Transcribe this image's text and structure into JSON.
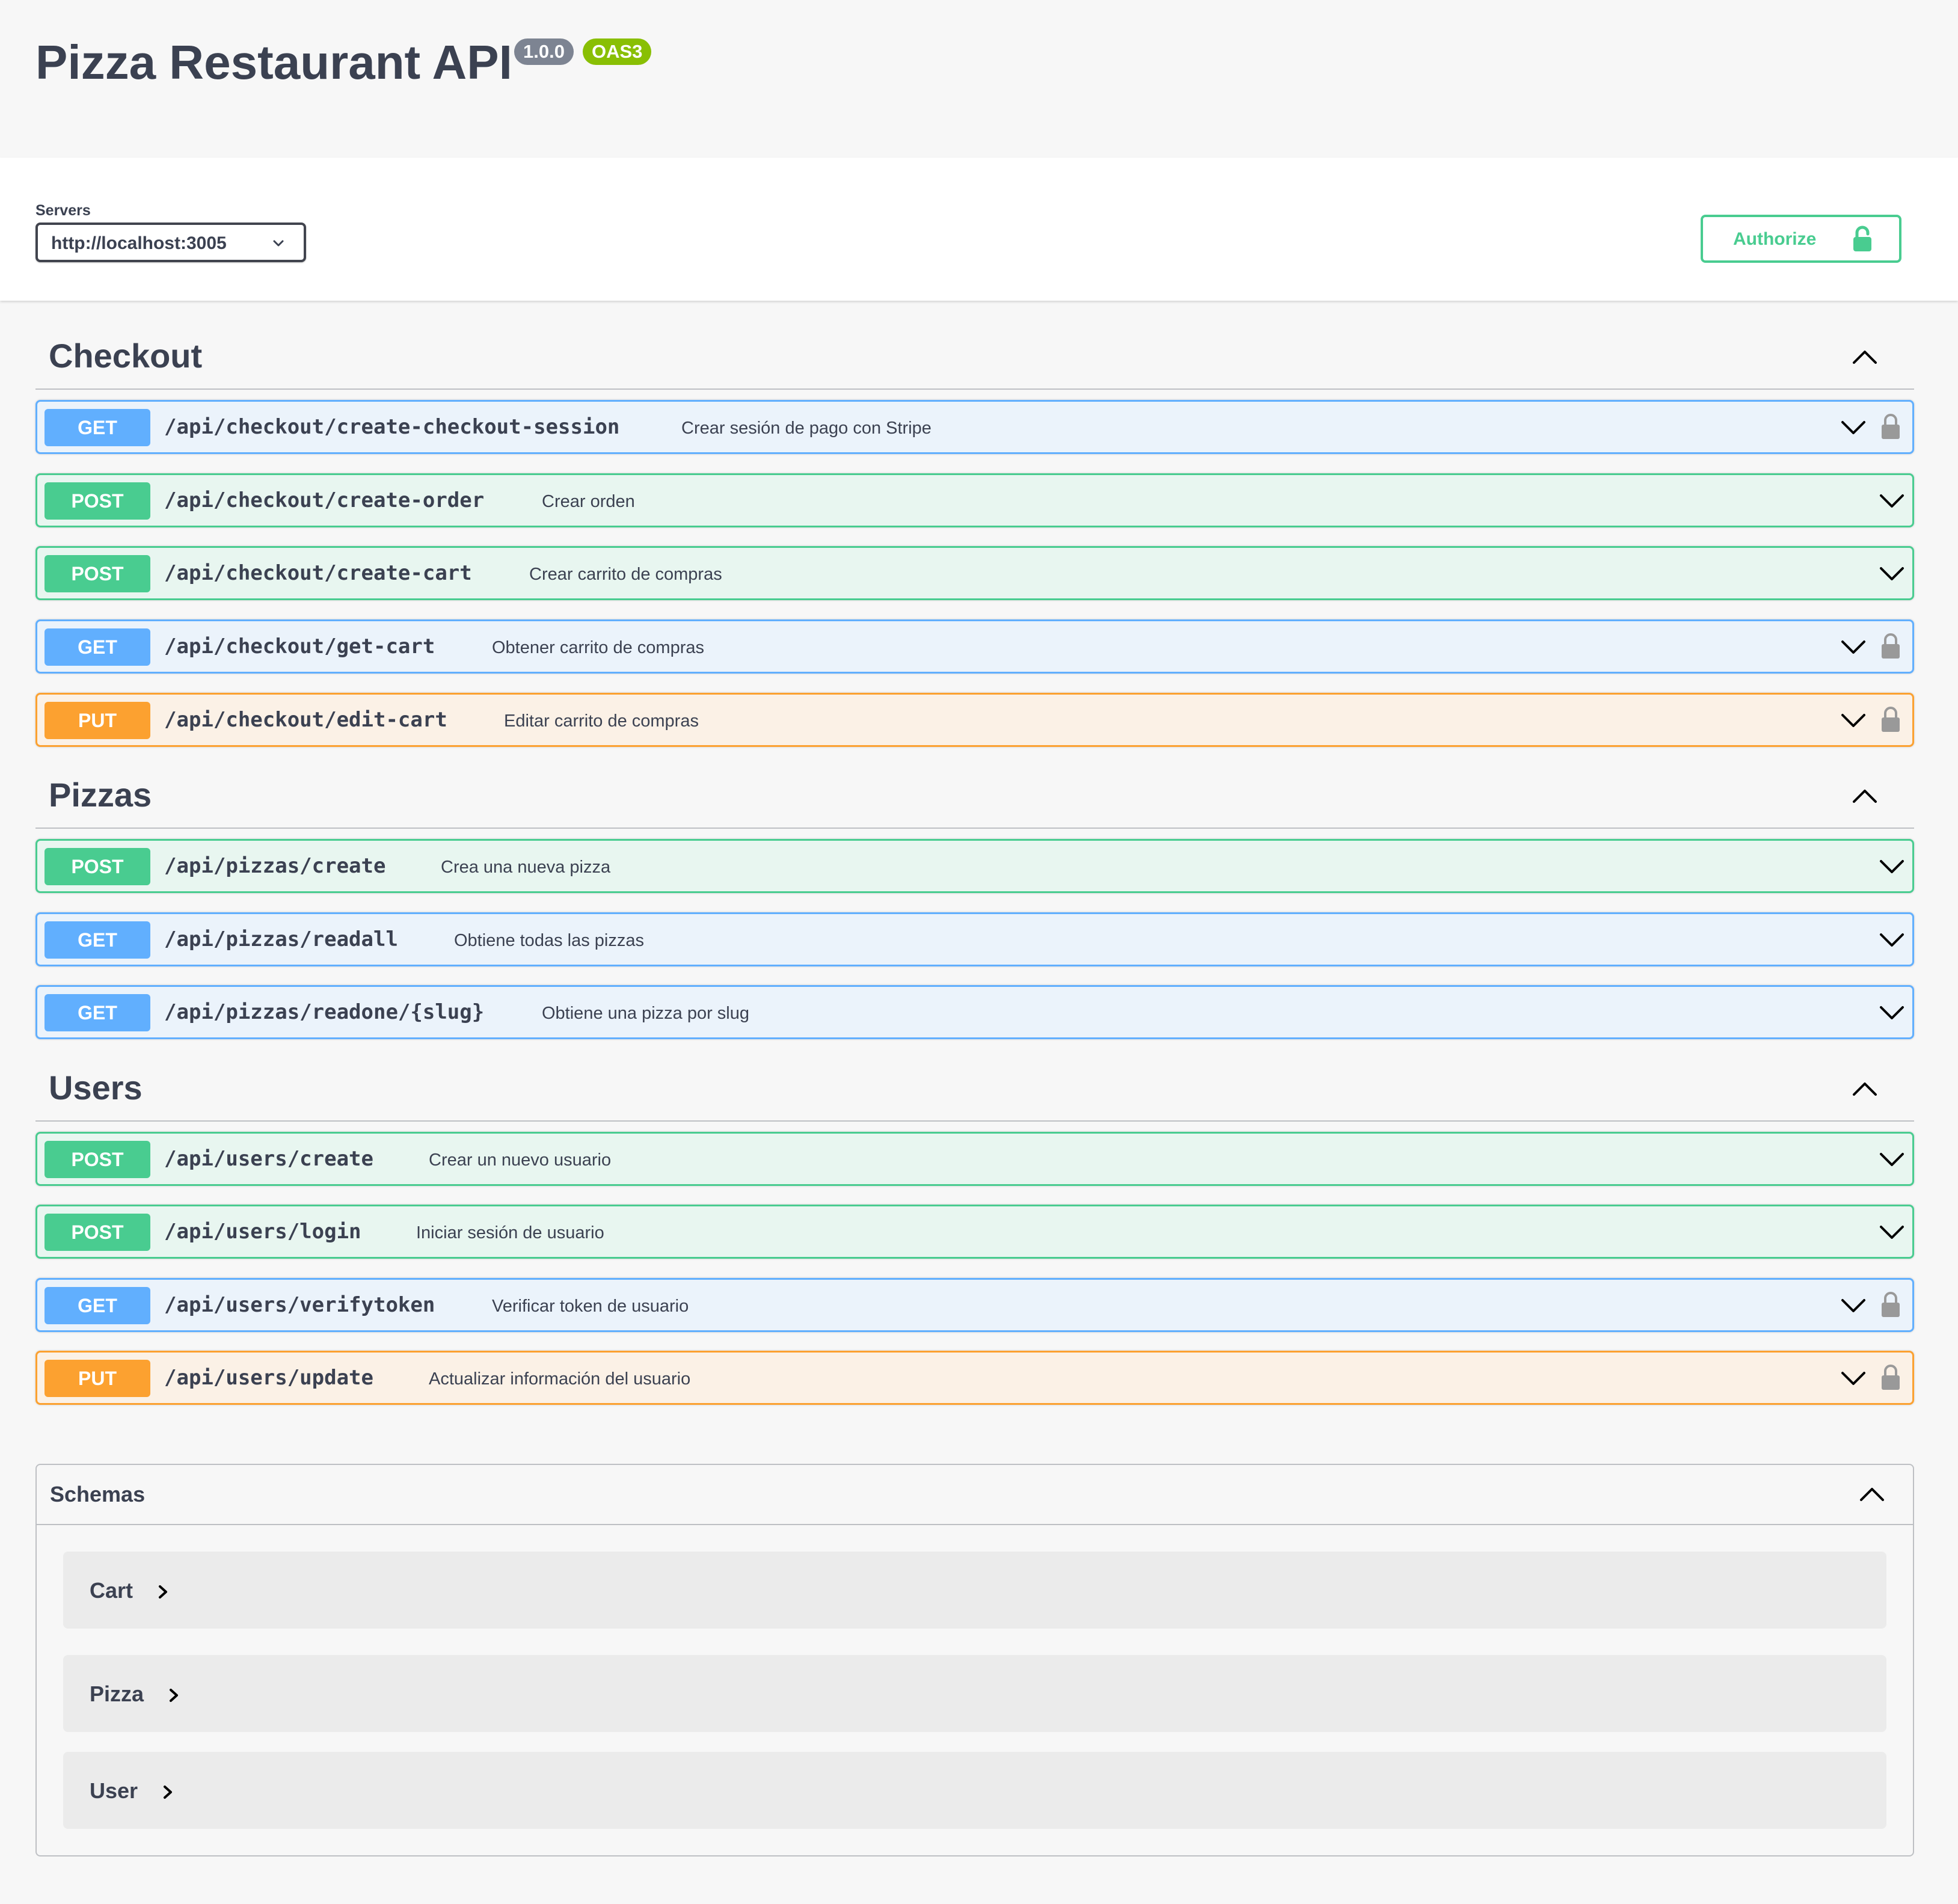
{
  "info": {
    "title": "Pizza Restaurant API",
    "version": "1.0.0",
    "oas": "OAS3"
  },
  "servers": {
    "label": "Servers",
    "selected": "http://localhost:3005"
  },
  "authorize": {
    "label": "Authorize"
  },
  "colors": {
    "get": "#61affe",
    "post": "#49cc90",
    "put": "#fca130",
    "authorize": "#49cc90"
  },
  "tags": [
    {
      "name": "Checkout",
      "operations": [
        {
          "method": "GET",
          "path": "/api/checkout/create-checkout-session",
          "summary": "Crear sesión de pago con Stripe",
          "locked": true
        },
        {
          "method": "POST",
          "path": "/api/checkout/create-order",
          "summary": "Crear orden",
          "locked": false
        },
        {
          "method": "POST",
          "path": "/api/checkout/create-cart",
          "summary": "Crear carrito de compras",
          "locked": false
        },
        {
          "method": "GET",
          "path": "/api/checkout/get-cart",
          "summary": "Obtener carrito de compras",
          "locked": true
        },
        {
          "method": "PUT",
          "path": "/api/checkout/edit-cart",
          "summary": "Editar carrito de compras",
          "locked": true
        }
      ]
    },
    {
      "name": "Pizzas",
      "operations": [
        {
          "method": "POST",
          "path": "/api/pizzas/create",
          "summary": "Crea una nueva pizza",
          "locked": false
        },
        {
          "method": "GET",
          "path": "/api/pizzas/readall",
          "summary": "Obtiene todas las pizzas",
          "locked": false
        },
        {
          "method": "GET",
          "path": "/api/pizzas/readone/{slug}",
          "summary": "Obtiene una pizza por slug",
          "locked": false
        }
      ]
    },
    {
      "name": "Users",
      "operations": [
        {
          "method": "POST",
          "path": "/api/users/create",
          "summary": "Crear un nuevo usuario",
          "locked": false
        },
        {
          "method": "POST",
          "path": "/api/users/login",
          "summary": "Iniciar sesión de usuario",
          "locked": false
        },
        {
          "method": "GET",
          "path": "/api/users/verifytoken",
          "summary": "Verificar token de usuario",
          "locked": true
        },
        {
          "method": "PUT",
          "path": "/api/users/update",
          "summary": "Actualizar información del usuario",
          "locked": true
        }
      ]
    }
  ],
  "schemas": {
    "title": "Schemas",
    "items": [
      "Cart",
      "Pizza",
      "User"
    ]
  }
}
